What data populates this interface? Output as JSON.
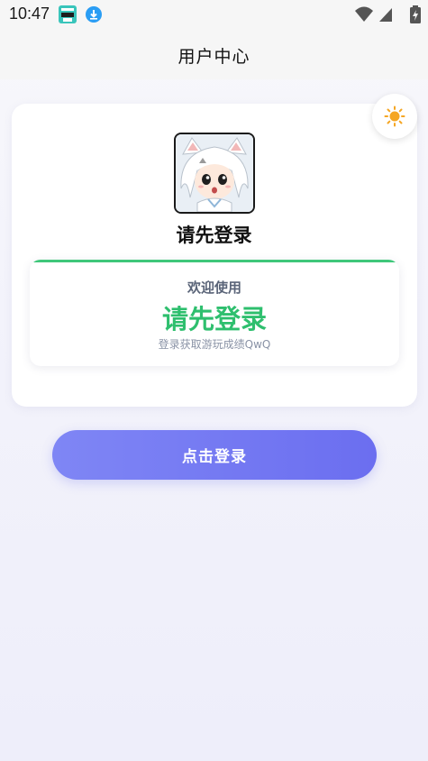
{
  "status_bar": {
    "time": "10:47",
    "app_icon": "anime-app-icon",
    "download_icon": "download-icon",
    "wifi_icon": "wifi-icon",
    "signal_icon": "signal-icon",
    "battery_icon": "battery-charging-icon"
  },
  "header": {
    "title": "用户中心"
  },
  "theme_toggle": {
    "icon": "sun-icon",
    "color": "#f5a623"
  },
  "profile": {
    "name": "请先登录"
  },
  "welcome": {
    "label": "欢迎使用",
    "main": "请先登录",
    "sub": "登录获取游玩成绩QwQ",
    "accent_color": "#2ebf6e"
  },
  "login_button": {
    "label": "点击登录",
    "color": "#6b6ef0"
  }
}
